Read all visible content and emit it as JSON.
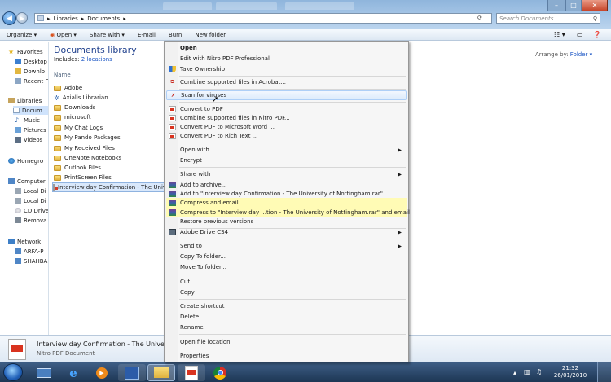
{
  "window": {
    "breadcrumb": [
      "Libraries",
      "Documents"
    ],
    "search_placeholder": "Search Documents"
  },
  "toolbar": {
    "organize": "Organize",
    "open": "Open",
    "share_with": "Share with",
    "email": "E-mail",
    "burn": "Burn",
    "new_folder": "New folder"
  },
  "nav": {
    "favorites": "Favorites",
    "desktop": "Desktop",
    "downloads": "Downlo",
    "recent": "Recent F",
    "libraries": "Libraries",
    "documents": "Docum",
    "music": "Music",
    "pictures": "Pictures",
    "videos": "Videos",
    "homegroup": "Homegro",
    "computer": "Computer",
    "local_c": "Local Di",
    "local_d": "Local Di",
    "cd_drive": "CD Drive",
    "removable": "Remova",
    "network": "Network",
    "net1": "ARFA-P",
    "net2": "SHAHBA"
  },
  "library": {
    "title": "Documents library",
    "includes_prefix": "Includes: ",
    "includes_link": "2 locations",
    "arrange_label": "Arrange by:",
    "arrange_value": "Folder",
    "column_name": "Name"
  },
  "files": [
    {
      "name": "Adobe",
      "icon": "folder-icon"
    },
    {
      "name": "Axialis Librarian",
      "icon": "gear-icon"
    },
    {
      "name": "Downloads",
      "icon": "folder-icon"
    },
    {
      "name": "microsoft",
      "icon": "folder-icon"
    },
    {
      "name": "My Chat Logs",
      "icon": "folder-icon"
    },
    {
      "name": "My Pando Packages",
      "icon": "folder-icon"
    },
    {
      "name": "My Received Files",
      "icon": "folder-icon"
    },
    {
      "name": "OneNote Notebooks",
      "icon": "folder-icon"
    },
    {
      "name": "Outlook Files",
      "icon": "folder-icon"
    },
    {
      "name": "PrintScreen Files",
      "icon": "folder-icon"
    },
    {
      "name": "Interview day Confirmation - The Univer",
      "icon": "pdf-icon"
    }
  ],
  "details": {
    "filename": "Interview day Confirmation - The Universi... Da",
    "filetype": "Nitro PDF Document"
  },
  "menu": {
    "open": "Open",
    "edit_nitro": "Edit with Nitro PDF Professional",
    "take_ownership": "Take Ownership",
    "combine_acrobat": "Combine supported files in Acrobat...",
    "scan_viruses": "Scan for viruses",
    "convert_pdf": "Convert to PDF",
    "combine_nitro": "Combine supported files in Nitro PDF...",
    "convert_word": "Convert PDF to Microsoft Word ...",
    "convert_rtf": "Convert PDF to Rich Text ...",
    "open_with": "Open with",
    "encrypt": "Encrypt",
    "share_with": "Share with",
    "add_archive": "Add to archive...",
    "add_rar": "Add to \"Interview day Confirmation - The University of Nottingham.rar\"",
    "compress_email": "Compress and email...",
    "compress_rar_email": "Compress to \"Interview day ...tion - The University of Nottingham.rar\" and email",
    "restore": "Restore previous versions",
    "adobe_drive": "Adobe Drive CS4",
    "send_to": "Send to",
    "copy_folder": "Copy To folder...",
    "move_folder": "Move To folder...",
    "cut": "Cut",
    "copy": "Copy",
    "create_shortcut": "Create shortcut",
    "delete": "Delete",
    "rename": "Rename",
    "open_location": "Open file location",
    "properties": "Properties"
  },
  "clock": {
    "time": "21:32",
    "date": "26/01/2010"
  }
}
